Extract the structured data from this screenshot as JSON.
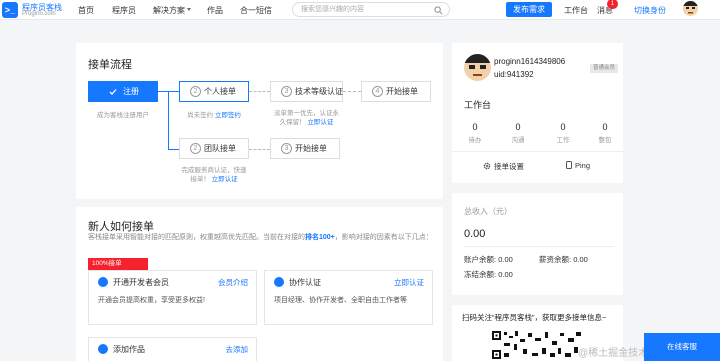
{
  "header": {
    "logo_mark": "&gt;_",
    "logo_title": "程序员客栈",
    "logo_sub": "Proginn.com",
    "nav": [
      "首页",
      "程序员",
      "解决方案",
      "作品",
      "合一短信"
    ],
    "nav_dropdown_index": 2,
    "search_placeholder": "搜索您感兴趣的内容",
    "publish": "发布需求",
    "workbench": "工作台",
    "messages": "消息",
    "message_count": "1",
    "switch_role": "切换身份"
  },
  "process": {
    "title": "接单流程",
    "steps": {
      "register": {
        "label": "注册",
        "desc": "成为客栈注册用户"
      },
      "personal": {
        "num": "2",
        "label": "个人接单",
        "desc": "尚未签约",
        "link": "立即签约"
      },
      "tech": {
        "num": "3",
        "label": "技术等级认证",
        "desc1": "派单第一优先，认证永",
        "desc2": "久保留！",
        "link": "立即认证"
      },
      "start1": {
        "num": "4",
        "label": "开始接单"
      },
      "team": {
        "num": "2",
        "label": "团队接单",
        "desc1": "完成服务商认证，快速",
        "desc2": "接单！",
        "link": "立即认证"
      },
      "start2": {
        "num": "3",
        "label": "开始接单"
      }
    }
  },
  "newbie": {
    "title": "新人如何接单",
    "desc_prefix": "客栈接单采用智能对接的匹配原则，权重越高优先匹配。当前在对接的",
    "desc_highlight": "排名100+",
    "desc_suffix": "，影响对接的因素有以下几点：",
    "desc_tail": "下几点:",
    "ribbon": "100%接单",
    "features": [
      {
        "title": "开通开发者会员",
        "link": "会员介绍",
        "desc": "开通会员提高权重，享受更多权益!"
      },
      {
        "title": "协作认证",
        "link": "立即认证",
        "desc": "项目经理、协作开发者、全职自由工作者等"
      },
      {
        "title": "添加作品",
        "link": "去添加"
      }
    ]
  },
  "profile": {
    "username": "proginn1614349806",
    "uid": "uid:941392",
    "tag": "普通会员",
    "workbench_label": "工作台",
    "stats": [
      {
        "value": "0",
        "label": "待办"
      },
      {
        "value": "0",
        "label": "沟通"
      },
      {
        "value": "0",
        "label": "工作"
      },
      {
        "value": "0",
        "label": "整包"
      }
    ],
    "settings": "接单设置",
    "ping": "Ping"
  },
  "income": {
    "title": "总收入（元）",
    "total": "0.00",
    "account_label": "账户余额:",
    "account": "0.00",
    "salary_label": "薪资余额:",
    "salary": "0.00",
    "frozen_label": "冻结余额:",
    "frozen": "0.00"
  },
  "qr": {
    "text": "扫码关注“程序员客栈”，获取更多接单信息~",
    "watermark": "@稀土掘金技术社区",
    "float_btn": "在线客服"
  },
  "colors": {
    "accent": "#1677ff",
    "ribbon": "#f5222d",
    "background": "#f4f5f7"
  }
}
